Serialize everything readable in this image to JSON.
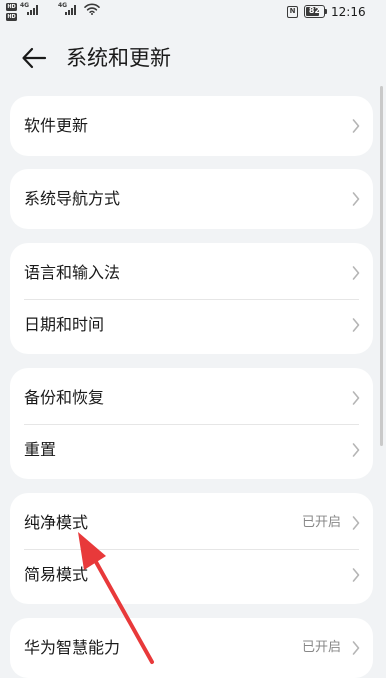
{
  "status_bar": {
    "sim_badges": [
      "HD",
      "HD"
    ],
    "signals": [
      {
        "gen": "4G",
        "level": 4
      },
      {
        "gen": "4G",
        "level": 4
      }
    ],
    "nfc_label": "N",
    "battery": "82",
    "battery_level": 0.82,
    "time": "12:16"
  },
  "header": {
    "title": "系统和更新",
    "back_icon": "arrow-left-icon"
  },
  "groups": [
    {
      "items": [
        {
          "label": "软件更新",
          "value": ""
        }
      ]
    },
    {
      "items": [
        {
          "label": "系统导航方式",
          "value": ""
        }
      ]
    },
    {
      "items": [
        {
          "label": "语言和输入法",
          "value": ""
        },
        {
          "label": "日期和时间",
          "value": ""
        }
      ]
    },
    {
      "items": [
        {
          "label": "备份和恢复",
          "value": ""
        },
        {
          "label": "重置",
          "value": ""
        }
      ]
    },
    {
      "items": [
        {
          "label": "纯净模式",
          "value": "已开启"
        },
        {
          "label": "简易模式",
          "value": ""
        }
      ]
    },
    {
      "items": [
        {
          "label": "华为智慧能力",
          "value": "已开启"
        }
      ]
    }
  ],
  "icons": {
    "chevron": "chevron-right-icon",
    "wifi": "wifi-icon",
    "nfc": "nfc-icon",
    "battery": "battery-icon"
  },
  "colors": {
    "background": "#f1f3f5",
    "card": "#ffffff",
    "text": "#1a1a1a",
    "secondary_text": "#888888",
    "chevron": "#b5b5b5",
    "annotation_arrow": "#e8393a"
  }
}
